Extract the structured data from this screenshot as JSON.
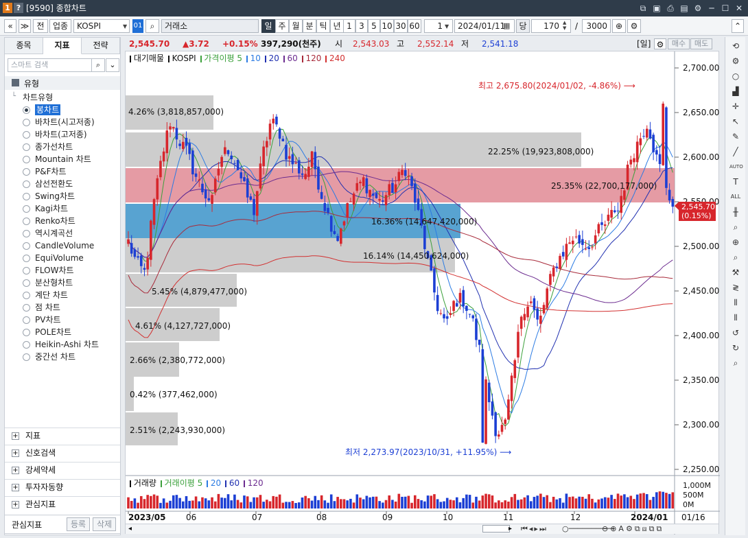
{
  "window": {
    "title": "[9590] 종합차트",
    "badge1": "1",
    "badge2": "?"
  },
  "toolbar": {
    "nav_prev": "«",
    "nav_down": "»",
    "prev_label": "전",
    "market_label": "업종",
    "symbol": "KOSPI",
    "symbol_code": "01",
    "exchange": "거래소",
    "periods": [
      "일",
      "주",
      "월",
      "분",
      "틱",
      "년"
    ],
    "selected_period": "일",
    "intervals": [
      "1",
      "3",
      "5",
      "10",
      "30",
      "60"
    ],
    "count": "1",
    "date": "2024/01/11",
    "dang_label": "당",
    "bars": "170",
    "slash": "/",
    "total": "3000"
  },
  "quote": {
    "price": "2,545.70",
    "change": "▲3.72",
    "pct": "+0.15%",
    "volume": "397,290(천주)",
    "open_label": "시",
    "open": "2,543.03",
    "high_label": "고",
    "high": "2,552.14",
    "low_label": "저",
    "low": "2,541.18",
    "period_tag": "[일]",
    "buy_label": "매수",
    "sell_label": "매도"
  },
  "sidebar": {
    "tabs": [
      "종목",
      "지표",
      "전략"
    ],
    "selected_tab": "지표",
    "search_placeholder": "스마트 검색",
    "type_header": "유형",
    "type_group": "차트유형",
    "chart_types": [
      "봉차트",
      "바차트(시고저종)",
      "바차트(고저종)",
      "종가선차트",
      "Mountain 차트",
      "P&F차트",
      "삼선전환도",
      "Swing차트",
      "Kagi차트",
      "Renko차트",
      "역시계곡선",
      "CandleVolume",
      "EquiVolume",
      "FLOW차트",
      "분산형차트",
      "계단 차트",
      "점 차트",
      "PV차트",
      "POLE차트",
      "Heikin-Ashi 차트",
      "중간선 차트"
    ],
    "selected_type": "봉차트",
    "sections": [
      "지표",
      "신호검색",
      "강세약세",
      "투자자동향",
      "관심지표"
    ],
    "footer_label": "관심지표",
    "register_label": "등록",
    "delete_label": "삭제"
  },
  "main_legend": {
    "prefix": "대기매물",
    "symbol": "KOSPI",
    "ma_label": "가격이평 5",
    "ma": [
      "10",
      "20",
      "60",
      "120",
      "240"
    ]
  },
  "vol_legend": {
    "prefix": "거래량",
    "ma_label": "거래이평 5",
    "ma": [
      "20",
      "60",
      "120"
    ]
  },
  "colors": {
    "up": "#d7262c",
    "down": "#1c3fd4",
    "ma5": "#3ba03b",
    "ma10": "#2b7be3",
    "ma20": "#2030b0",
    "ma60": "#6b2b8f",
    "ma120": "#a82a3a",
    "ma240": "#d23030",
    "accent": "#2f3c4a"
  },
  "annotations": {
    "high": "최고 2,675.80(2024/01/02, -4.86%)",
    "low": "최저 2,273.97(2023/10/31, +11.95%)",
    "current_price": "2,545.70",
    "current_pct": "(0.15%)"
  },
  "price_axis": {
    "ticks": [
      "2,700.00",
      "2,650.00",
      "2,600.00",
      "2,550.00",
      "2,500.00",
      "2,450.00",
      "2,400.00",
      "2,350.00",
      "2,300.00",
      "2,250.00"
    ]
  },
  "volume_axis": {
    "ticks": [
      "1,000M",
      "500M",
      "0M"
    ]
  },
  "time_axis": {
    "labels": [
      "2023/05",
      "06",
      "07",
      "08",
      "09",
      "10",
      "11",
      "12",
      "2024/01"
    ],
    "right_label": "01/16"
  },
  "chart_data": {
    "type": "candlestick",
    "symbol": "KOSPI",
    "x": [
      "2023/05",
      "06",
      "07",
      "08",
      "09",
      "10",
      "11",
      "12",
      "2024/01"
    ],
    "ylim": [
      2250,
      2700
    ],
    "high": {
      "value": 2675.8,
      "date": "2024/01/02"
    },
    "low": {
      "value": 2273.97,
      "date": "2023/10/31"
    },
    "last": {
      "close": 2545.7,
      "open": 2543.03,
      "high": 2552.14,
      "low": 2541.18,
      "change": 3.72,
      "pct": 0.15,
      "volume_k": 397290
    },
    "volume_profile": [
      {
        "pct": "4.26%",
        "volume": "(3,818,857,000)",
        "value": 3818857000,
        "share": 4.26
      },
      {
        "pct": "22.25%",
        "volume": "(19,923,808,000)",
        "value": 19923808000,
        "share": 22.25
      },
      {
        "pct": "25.35%",
        "volume": "(22,700,177,000)",
        "value": 22700177000,
        "share": 25.35
      },
      {
        "pct": "16.36%",
        "volume": "(14,647,420,000)",
        "value": 14647420000,
        "share": 16.36
      },
      {
        "pct": "16.14%",
        "volume": "(14,450,624,000)",
        "value": 14450624000,
        "share": 16.14
      },
      {
        "pct": "5.45%",
        "volume": "(4,879,477,000)",
        "value": 4879477000,
        "share": 5.45
      },
      {
        "pct": "4.61%",
        "volume": "(4,127,727,000)",
        "value": 4127727000,
        "share": 4.61
      },
      {
        "pct": "2.66%",
        "volume": "(2,380,772,000)",
        "value": 2380772000,
        "share": 2.66
      },
      {
        "pct": "0.42%",
        "volume": "(377,462,000)",
        "value": 377462000,
        "share": 0.42
      },
      {
        "pct": "2.51%",
        "volume": "(2,243,930,000)",
        "value": 2243930000,
        "share": 2.51
      }
    ],
    "close_path": [
      2505,
      2480,
      2470,
      2545,
      2600,
      2640,
      2620,
      2605,
      2580,
      2560,
      2550,
      2600,
      2610,
      2590,
      2560,
      2540,
      2600,
      2640,
      2630,
      2600,
      2590,
      2580,
      2600,
      2560,
      2530,
      2510,
      2540,
      2560,
      2575,
      2560,
      2550,
      2560,
      2570,
      2590,
      2560,
      2520,
      2470,
      2430,
      2410,
      2440,
      2440,
      2420,
      2380,
      2330,
      2290,
      2300,
      2360,
      2430,
      2440,
      2410,
      2450,
      2480,
      2495,
      2510,
      2505,
      2500,
      2515,
      2525,
      2540,
      2560,
      2600,
      2620,
      2640,
      2600,
      2575,
      2545
    ]
  }
}
